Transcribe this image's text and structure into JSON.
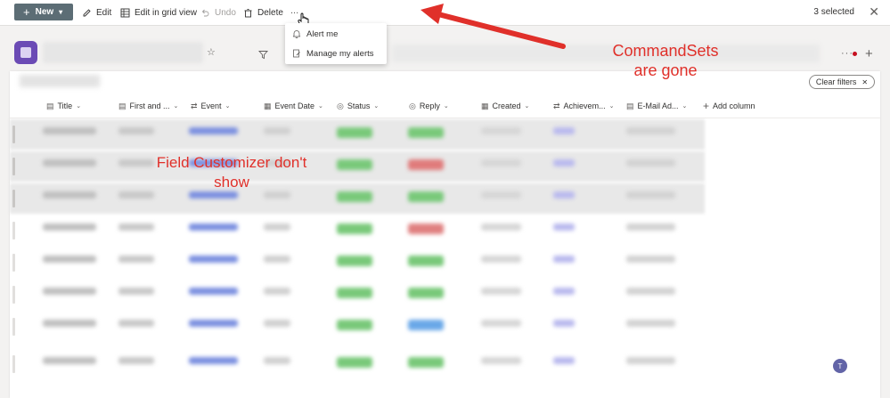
{
  "command_bar": {
    "new_label": "New",
    "edit_label": "Edit",
    "grid_label": "Edit in grid view",
    "undo_label": "Undo",
    "delete_label": "Delete",
    "more_label": "...",
    "selected_text": "3 selected"
  },
  "menu": {
    "items": [
      {
        "label": "Alert me",
        "icon": "bell-icon"
      },
      {
        "label": "Manage my alerts",
        "icon": "alert-edit-icon"
      }
    ]
  },
  "list": {
    "clear_filters_label": "Clear filters",
    "columns": [
      "Title",
      "First and ...",
      "Event",
      "Event Date",
      "Status",
      "Reply",
      "Created",
      "Achievem...",
      "E-Mail Ad...",
      "Add column"
    ]
  },
  "annotations": {
    "commandsets_line1": "CommandSets",
    "commandsets_line2": "are gone",
    "field_line1": "Field Customizer don't",
    "field_line2": "show"
  },
  "colors": {
    "annotation": "#e0302a",
    "new_button": "#5c6d75",
    "site_logo": "#6b4bb5"
  }
}
